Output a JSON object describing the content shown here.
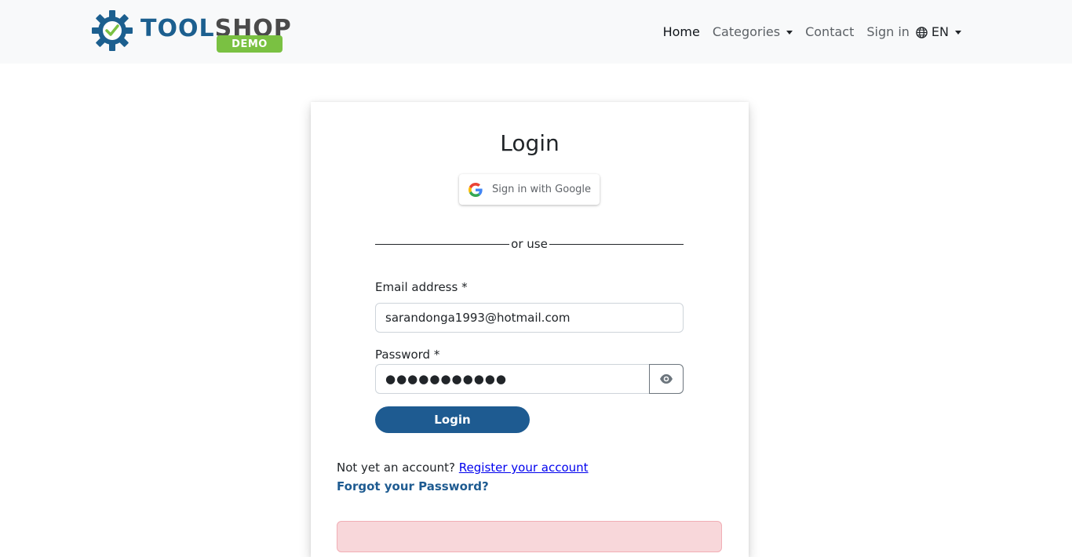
{
  "brand": {
    "name_part1": "TOOL",
    "name_part2": "SHOP",
    "badge": "DEMO",
    "colors": {
      "primary": "#1c5f8f",
      "secondary": "#4a4a4a",
      "badge": "#7ac142",
      "check": "#7ac142"
    }
  },
  "nav": {
    "home": "Home",
    "categories": "Categories",
    "contact": "Contact",
    "sign_in": "Sign in",
    "language": "EN"
  },
  "login": {
    "title": "Login",
    "google_button": "Sign in with Google",
    "divider_text": "or use",
    "email_label": "Email address *",
    "email_value": "sarandonga1993@hotmail.com",
    "password_label": "Password *",
    "password_value": "●●●●●●●●●●●",
    "submit_label": "Login",
    "register_prompt": "Not yet an account?",
    "register_link": "Register your account",
    "forgot_link": "Forgot your Password?"
  },
  "icons": {
    "logo": "gear-check-icon",
    "google": "google-g-icon",
    "globe": "globe-icon",
    "eye": "eye-icon",
    "caret": "caret-down-icon"
  },
  "colors": {
    "accent": "#1e5b91",
    "alert_bg": "#f8d7da",
    "navbar_bg": "#f8f9fa"
  }
}
